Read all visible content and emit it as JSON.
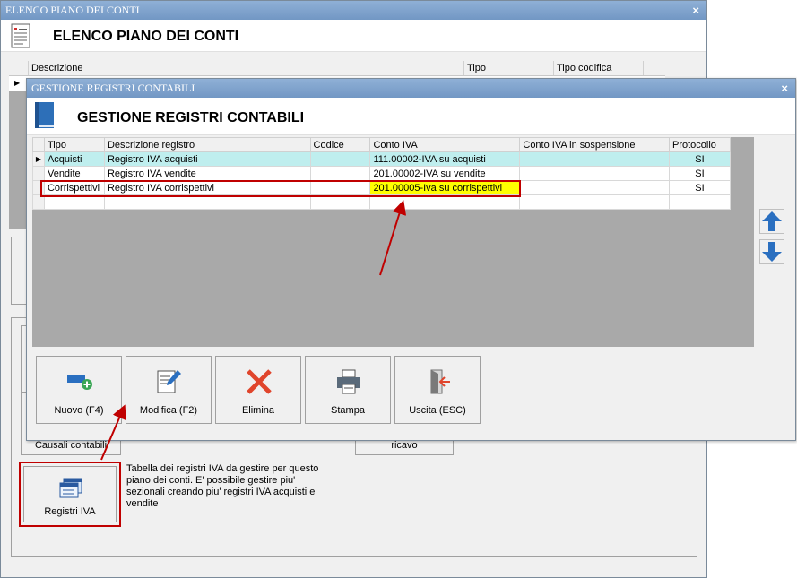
{
  "bg_window": {
    "title": "ELENCO PIANO DEI CONTI",
    "close": "×",
    "header_title": "ELENCO PIANO DEI CONTI",
    "grid_headers": [
      "Descrizione",
      "Tipo",
      "Tipo codifica"
    ],
    "btn_causali": "Causali contabili",
    "btn_ricavo": "ricavo",
    "btn_registri": "Registri IVA",
    "registri_desc": "Tabella dei registri IVA da gestire per questo piano dei conti. E' possibile gestire piu' sezionali creando piu' registri IVA acquisti e vendite"
  },
  "fg_window": {
    "title": "GESTIONE REGISTRI CONTABILI",
    "close": "×",
    "header_title": "GESTIONE REGISTRI CONTABILI",
    "columns": [
      "Tipo",
      "Descrizione registro",
      "Codice",
      "Conto IVA",
      "Conto IVA in sospensione",
      "Protocollo"
    ],
    "rows": [
      {
        "tipo": "Acquisti",
        "descrizione": "Registro IVA acquisti",
        "codice": "",
        "conto_iva": "111.00002-IVA su acquisti",
        "sospensione": "",
        "protocollo": "SI"
      },
      {
        "tipo": "Vendite",
        "descrizione": "Registro IVA vendite",
        "codice": "",
        "conto_iva": "201.00002-IVA su vendite",
        "sospensione": "",
        "protocollo": "SI"
      },
      {
        "tipo": "Corrispettivi",
        "descrizione": "Registro IVA corrispettivi",
        "codice": "",
        "conto_iva": "201.00005-Iva su corrispettivi",
        "sospensione": "",
        "protocollo": "SI"
      }
    ],
    "buttons": {
      "nuovo": "Nuovo (F4)",
      "modifica": "Modifica (F2)",
      "elimina": "Elimina",
      "stampa": "Stampa",
      "uscita": "Uscita (ESC)"
    }
  },
  "icons": [
    "document-icon",
    "book-icon",
    "arrow-up-icon",
    "arrow-down-icon",
    "add-icon",
    "edit-icon",
    "delete-icon",
    "print-icon",
    "exit-icon",
    "registers-icon"
  ],
  "colors": {
    "titlebar": "#7a9fcc",
    "selected_row": "#bfeeee",
    "highlight": "#ffff00",
    "annotation": "#c00000"
  }
}
